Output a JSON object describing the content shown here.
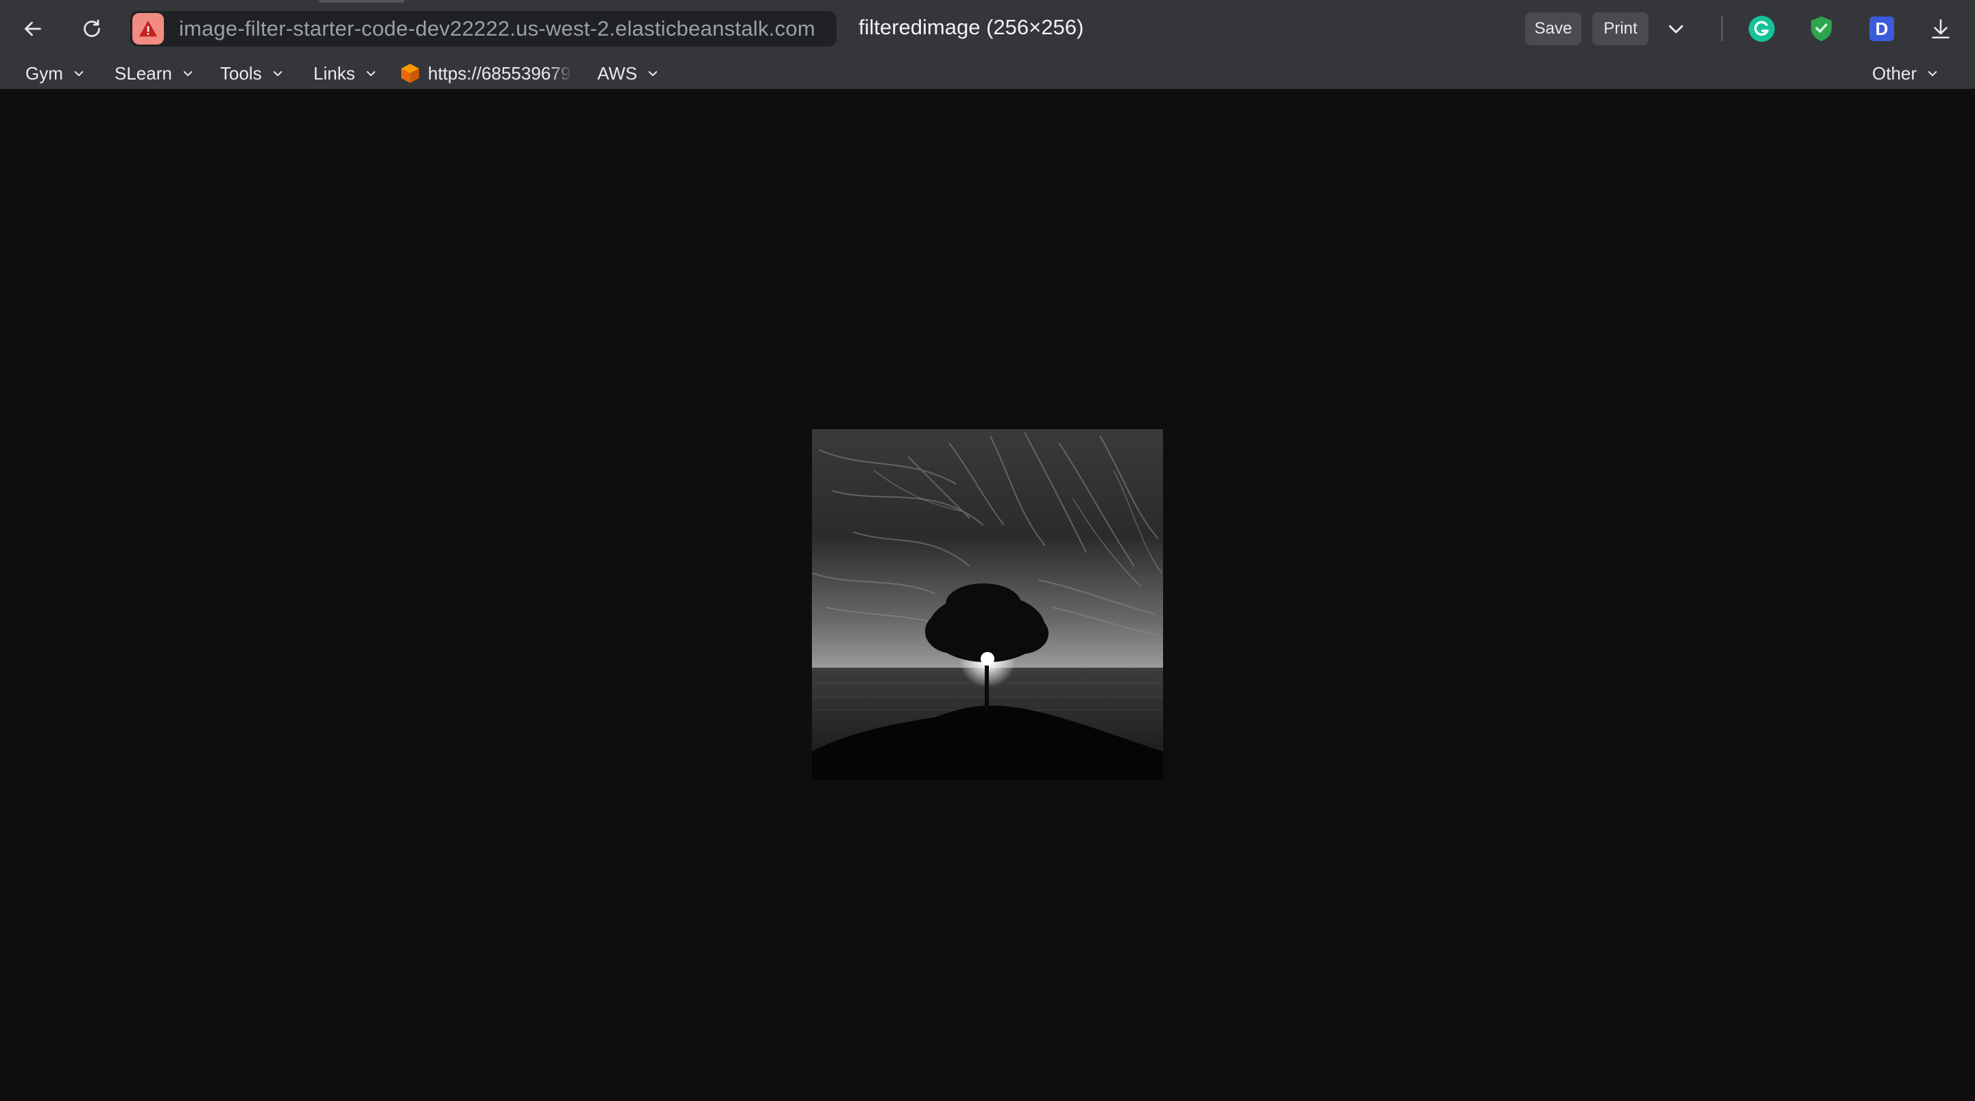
{
  "browser": {
    "address_bar": {
      "url": "image-filter-starter-code-dev22222.us-west-2.elasticbeanstalk.com",
      "security_icon": "warning-triangle-icon"
    },
    "tab_title": "filteredimage (256×256)",
    "toolbar": {
      "save_label": "Save",
      "print_label": "Print",
      "icons": [
        "back-arrow-icon",
        "reload-icon",
        "chevron-down-icon",
        "grammarly-icon",
        "shield-check-icon",
        "extension-d-icon",
        "download-icon"
      ],
      "extension_letter": "D"
    },
    "bookmarks": [
      {
        "label": "Gym",
        "folder": true
      },
      {
        "label": "SLearn",
        "folder": true
      },
      {
        "label": "Tools",
        "folder": true
      },
      {
        "label": "Links",
        "folder": true
      },
      {
        "label": "https://685539679",
        "folder": false,
        "icon": "aws-cube-icon"
      },
      {
        "label": "AWS",
        "folder": true
      }
    ],
    "other_bookmarks": "Other"
  },
  "viewer": {
    "image_alt": "grayscale image of a lone tree on a hill with sun behind it and streaked clouds"
  },
  "colors": {
    "chrome": "#35363a",
    "omnibox": "#202124",
    "background": "#0e0e0f",
    "warning": "#f28b82",
    "grammarly": "#15c39a",
    "shield": "#2ea44f",
    "extension": "#3b5bdb"
  }
}
